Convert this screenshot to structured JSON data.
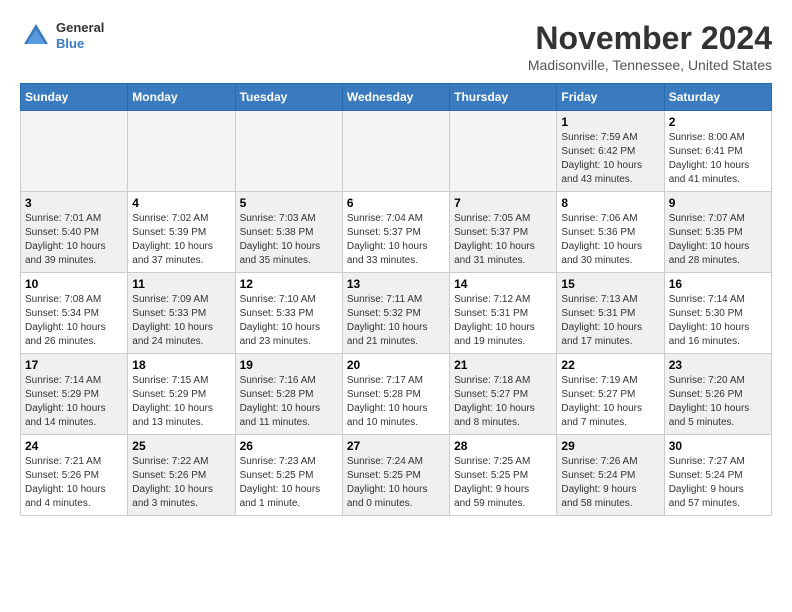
{
  "header": {
    "logo": {
      "general": "General",
      "blue": "Blue"
    },
    "title": "November 2024",
    "location": "Madisonville, Tennessee, United States"
  },
  "calendar": {
    "days_of_week": [
      "Sunday",
      "Monday",
      "Tuesday",
      "Wednesday",
      "Thursday",
      "Friday",
      "Saturday"
    ],
    "weeks": [
      [
        {
          "day": "",
          "empty": true
        },
        {
          "day": "",
          "empty": true
        },
        {
          "day": "",
          "empty": true
        },
        {
          "day": "",
          "empty": true
        },
        {
          "day": "",
          "empty": true
        },
        {
          "day": "1",
          "info": "Sunrise: 7:59 AM\nSunset: 6:42 PM\nDaylight: 10 hours\nand 43 minutes.",
          "shaded": true
        },
        {
          "day": "2",
          "info": "Sunrise: 8:00 AM\nSunset: 6:41 PM\nDaylight: 10 hours\nand 41 minutes.",
          "shaded": false
        }
      ],
      [
        {
          "day": "3",
          "info": "Sunrise: 7:01 AM\nSunset: 5:40 PM\nDaylight: 10 hours\nand 39 minutes.",
          "shaded": true
        },
        {
          "day": "4",
          "info": "Sunrise: 7:02 AM\nSunset: 5:39 PM\nDaylight: 10 hours\nand 37 minutes.",
          "shaded": false
        },
        {
          "day": "5",
          "info": "Sunrise: 7:03 AM\nSunset: 5:38 PM\nDaylight: 10 hours\nand 35 minutes.",
          "shaded": true
        },
        {
          "day": "6",
          "info": "Sunrise: 7:04 AM\nSunset: 5:37 PM\nDaylight: 10 hours\nand 33 minutes.",
          "shaded": false
        },
        {
          "day": "7",
          "info": "Sunrise: 7:05 AM\nSunset: 5:37 PM\nDaylight: 10 hours\nand 31 minutes.",
          "shaded": true
        },
        {
          "day": "8",
          "info": "Sunrise: 7:06 AM\nSunset: 5:36 PM\nDaylight: 10 hours\nand 30 minutes.",
          "shaded": false
        },
        {
          "day": "9",
          "info": "Sunrise: 7:07 AM\nSunset: 5:35 PM\nDaylight: 10 hours\nand 28 minutes.",
          "shaded": true
        }
      ],
      [
        {
          "day": "10",
          "info": "Sunrise: 7:08 AM\nSunset: 5:34 PM\nDaylight: 10 hours\nand 26 minutes.",
          "shaded": false
        },
        {
          "day": "11",
          "info": "Sunrise: 7:09 AM\nSunset: 5:33 PM\nDaylight: 10 hours\nand 24 minutes.",
          "shaded": true
        },
        {
          "day": "12",
          "info": "Sunrise: 7:10 AM\nSunset: 5:33 PM\nDaylight: 10 hours\nand 23 minutes.",
          "shaded": false
        },
        {
          "day": "13",
          "info": "Sunrise: 7:11 AM\nSunset: 5:32 PM\nDaylight: 10 hours\nand 21 minutes.",
          "shaded": true
        },
        {
          "day": "14",
          "info": "Sunrise: 7:12 AM\nSunset: 5:31 PM\nDaylight: 10 hours\nand 19 minutes.",
          "shaded": false
        },
        {
          "day": "15",
          "info": "Sunrise: 7:13 AM\nSunset: 5:31 PM\nDaylight: 10 hours\nand 17 minutes.",
          "shaded": true
        },
        {
          "day": "16",
          "info": "Sunrise: 7:14 AM\nSunset: 5:30 PM\nDaylight: 10 hours\nand 16 minutes.",
          "shaded": false
        }
      ],
      [
        {
          "day": "17",
          "info": "Sunrise: 7:14 AM\nSunset: 5:29 PM\nDaylight: 10 hours\nand 14 minutes.",
          "shaded": true
        },
        {
          "day": "18",
          "info": "Sunrise: 7:15 AM\nSunset: 5:29 PM\nDaylight: 10 hours\nand 13 minutes.",
          "shaded": false
        },
        {
          "day": "19",
          "info": "Sunrise: 7:16 AM\nSunset: 5:28 PM\nDaylight: 10 hours\nand 11 minutes.",
          "shaded": true
        },
        {
          "day": "20",
          "info": "Sunrise: 7:17 AM\nSunset: 5:28 PM\nDaylight: 10 hours\nand 10 minutes.",
          "shaded": false
        },
        {
          "day": "21",
          "info": "Sunrise: 7:18 AM\nSunset: 5:27 PM\nDaylight: 10 hours\nand 8 minutes.",
          "shaded": true
        },
        {
          "day": "22",
          "info": "Sunrise: 7:19 AM\nSunset: 5:27 PM\nDaylight: 10 hours\nand 7 minutes.",
          "shaded": false
        },
        {
          "day": "23",
          "info": "Sunrise: 7:20 AM\nSunset: 5:26 PM\nDaylight: 10 hours\nand 5 minutes.",
          "shaded": true
        }
      ],
      [
        {
          "day": "24",
          "info": "Sunrise: 7:21 AM\nSunset: 5:26 PM\nDaylight: 10 hours\nand 4 minutes.",
          "shaded": false
        },
        {
          "day": "25",
          "info": "Sunrise: 7:22 AM\nSunset: 5:26 PM\nDaylight: 10 hours\nand 3 minutes.",
          "shaded": true
        },
        {
          "day": "26",
          "info": "Sunrise: 7:23 AM\nSunset: 5:25 PM\nDaylight: 10 hours\nand 1 minute.",
          "shaded": false
        },
        {
          "day": "27",
          "info": "Sunrise: 7:24 AM\nSunset: 5:25 PM\nDaylight: 10 hours\nand 0 minutes.",
          "shaded": true
        },
        {
          "day": "28",
          "info": "Sunrise: 7:25 AM\nSunset: 5:25 PM\nDaylight: 9 hours\nand 59 minutes.",
          "shaded": false
        },
        {
          "day": "29",
          "info": "Sunrise: 7:26 AM\nSunset: 5:24 PM\nDaylight: 9 hours\nand 58 minutes.",
          "shaded": true
        },
        {
          "day": "30",
          "info": "Sunrise: 7:27 AM\nSunset: 5:24 PM\nDaylight: 9 hours\nand 57 minutes.",
          "shaded": false
        }
      ]
    ]
  }
}
